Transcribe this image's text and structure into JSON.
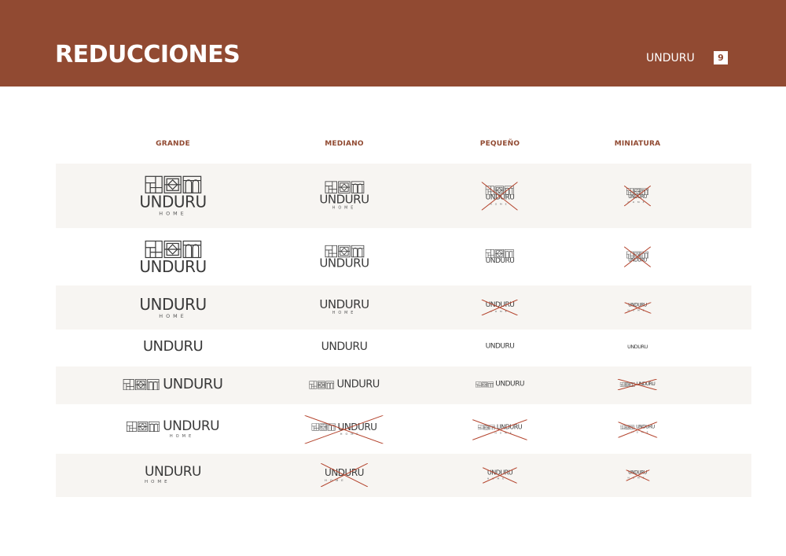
{
  "header": {
    "title": "REDUCCIONES",
    "brand": "UNDURU",
    "page_number": "9"
  },
  "columns": [
    "GRANDE",
    "MEDIANO",
    "PEQUEÑO",
    "MINIATURA"
  ],
  "logo": {
    "word": "UNDURU",
    "subtitle": "HOME"
  },
  "colors": {
    "brand": "#914a32",
    "shade": "#f7f5f2",
    "logo": "#3a3a3a",
    "cross": "#b3422b"
  },
  "rows": [
    {
      "variant": "stacked-icon-home",
      "crossed": [
        false,
        false,
        true,
        true
      ]
    },
    {
      "variant": "stacked-icon",
      "crossed": [
        false,
        false,
        false,
        true
      ]
    },
    {
      "variant": "word-home",
      "crossed": [
        false,
        false,
        true,
        true
      ]
    },
    {
      "variant": "word",
      "crossed": [
        false,
        false,
        false,
        false
      ]
    },
    {
      "variant": "inline-icon",
      "crossed": [
        false,
        false,
        false,
        true
      ]
    },
    {
      "variant": "inline-icon-home",
      "crossed": [
        false,
        true,
        true,
        true
      ]
    },
    {
      "variant": "word-home-left",
      "crossed": [
        false,
        true,
        true,
        true
      ]
    }
  ]
}
